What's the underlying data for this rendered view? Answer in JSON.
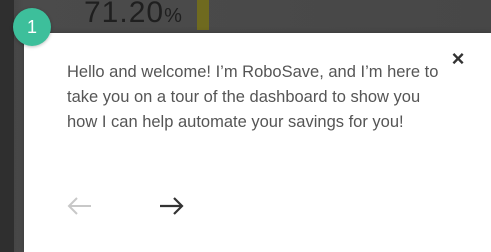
{
  "background": {
    "partial_value": "71.20",
    "partial_unit": "%"
  },
  "tour": {
    "step_number": "1",
    "message": "Hello and welcome! I’m RoboSave, and I’m here to take you on a tour of the dashboard to show you how I can help automate your savings for you!",
    "close_icon": "close-icon",
    "prev_icon": "arrow-left-icon",
    "next_icon": "arrow-right-icon",
    "prev_enabled": false,
    "next_enabled": true
  },
  "colors": {
    "badge": "#3dbf9b",
    "card": "#ffffff",
    "text": "#555555",
    "arrow_disabled": "#c8c8c8",
    "arrow_enabled": "#333333"
  }
}
